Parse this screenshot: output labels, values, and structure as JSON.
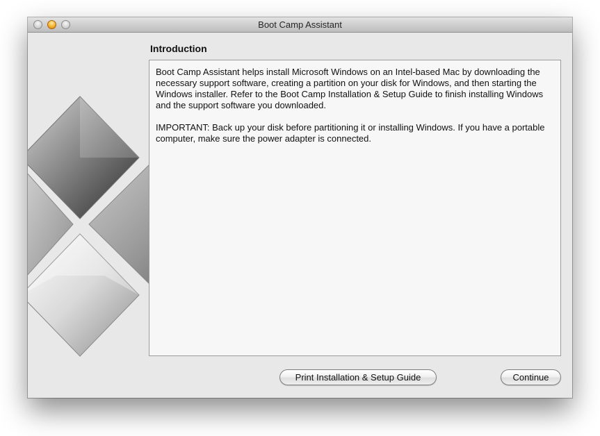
{
  "window": {
    "title": "Boot Camp Assistant"
  },
  "header": {
    "title": "Introduction"
  },
  "content": {
    "paragraphs": [
      "Boot Camp Assistant helps install Microsoft Windows on an Intel-based Mac by downloading the necessary support software, creating a partition on your disk for Windows, and then starting the Windows installer. Refer to the Boot Camp Installation & Setup Guide to finish installing Windows and the support software you downloaded.",
      "IMPORTANT:  Back up your disk before partitioning it or installing Windows. If you have a portable computer, make sure the power adapter is connected."
    ]
  },
  "buttons": {
    "print_label": "Print Installation & Setup Guide",
    "continue_label": "Continue"
  },
  "icons": {
    "close": "close-icon",
    "minimize": "minimize-icon",
    "zoom": "zoom-icon",
    "logo": "windows-logo-icon"
  },
  "colors": {
    "window_bg": "#e8e8e8",
    "panel_bg": "#f7f7f7",
    "minimize_accent": "#f5b22d"
  }
}
